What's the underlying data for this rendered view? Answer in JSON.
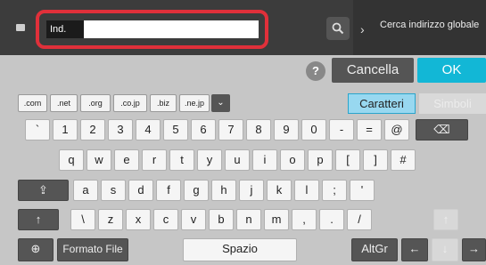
{
  "input": {
    "label": "Ind.",
    "value": ""
  },
  "global_button": {
    "label": "Cerca indirizzo globale",
    "chevron": "›"
  },
  "buttons": {
    "help": "?",
    "cancel": "Cancella",
    "ok": "OK"
  },
  "domains": [
    ".com",
    ".net",
    ".org",
    ".co.jp",
    ".biz",
    ".ne.jp"
  ],
  "domain_chevron": "⌄",
  "modes": {
    "characters": "Caratteri",
    "symbols": "Simboli"
  },
  "row1": [
    "`",
    "1",
    "2",
    "3",
    "4",
    "5",
    "6",
    "7",
    "8",
    "9",
    "0",
    "-",
    "=",
    "@"
  ],
  "row2": [
    "q",
    "w",
    "e",
    "r",
    "t",
    "y",
    "u",
    "i",
    "o",
    "p",
    "[",
    "]",
    "#"
  ],
  "row3": [
    "a",
    "s",
    "d",
    "f",
    "g",
    "h",
    "j",
    "k",
    "l",
    ";",
    "'"
  ],
  "row4": [
    "\\",
    "z",
    "x",
    "c",
    "v",
    "b",
    "n",
    "m",
    ",",
    ".",
    "/"
  ],
  "bottom": {
    "file_format": "Formato File",
    "space": "Spazio",
    "altgr": "AltGr"
  },
  "icons": {
    "backspace": "⌫",
    "caps": "⇪",
    "shift": "↑",
    "globe": "⊕",
    "left": "←",
    "down": "↓",
    "right": "→",
    "up": "↑"
  },
  "colors": {
    "accent": "#12b7d6",
    "highlight": "#e0303a"
  }
}
